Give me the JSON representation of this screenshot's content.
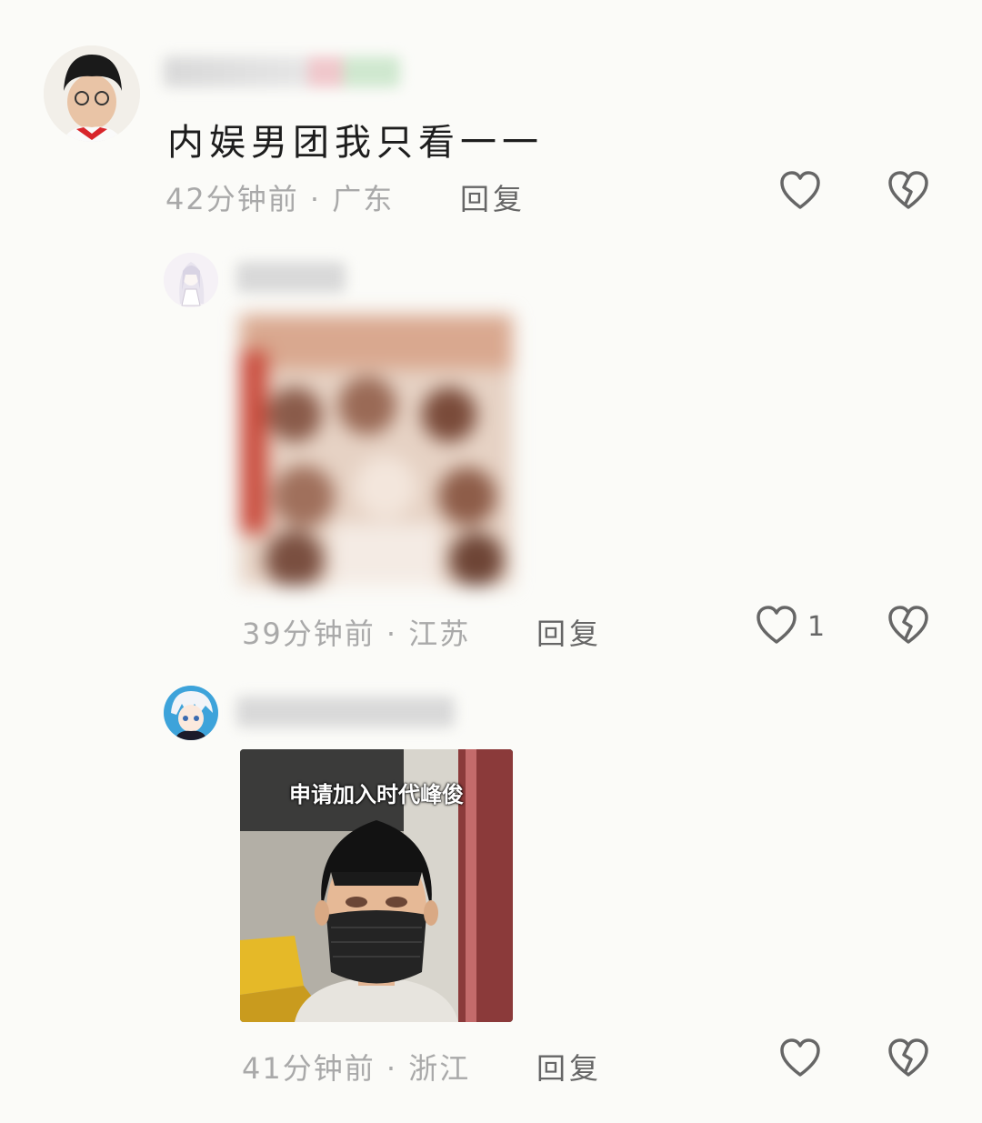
{
  "comments": [
    {
      "text": "内娱男团我只看一一",
      "time": "42分钟前",
      "location": "广东",
      "reply_label": "回复",
      "likes": ""
    },
    {
      "time": "39分钟前",
      "location": "江苏",
      "reply_label": "回复",
      "likes": "1"
    },
    {
      "image_caption": "申请加入时代峰俊",
      "time": "41分钟前",
      "location": "浙江",
      "reply_label": "回复",
      "likes": ""
    }
  ],
  "separator": "·",
  "icons": {
    "like": "heart-outline-icon",
    "dislike": "broken-heart-icon"
  },
  "colors": {
    "meta": "#a9a9a9",
    "icon": "#666666",
    "background": "#fbfbf8"
  }
}
